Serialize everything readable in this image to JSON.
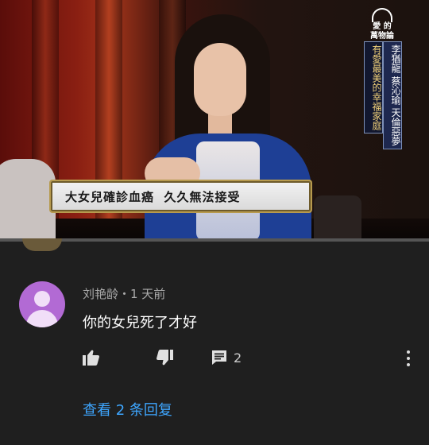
{
  "video": {
    "logo_text": "愛 的\n萬物論",
    "vertical_banner_1": "李猶龍 蔡沁瑜 天倫惡夢",
    "vertical_banner_2": "有愛最美的幸福家庭",
    "caption": "大女兒確診血癌  久久無法接受"
  },
  "comment": {
    "author_meta": "刘艳龄・1 天前",
    "text": "你的女兒死了才好",
    "reply_count": "2",
    "view_replies": "查看 2 条回复",
    "like_icon": "thumbs-up-icon",
    "dislike_icon": "thumbs-down-icon",
    "reply_icon": "reply-comment-icon",
    "more_icon": "more-vertical-icon"
  },
  "colors": {
    "background": "#1f1f1f",
    "link": "#3ea6ff",
    "avatar": "#b26ad4"
  }
}
